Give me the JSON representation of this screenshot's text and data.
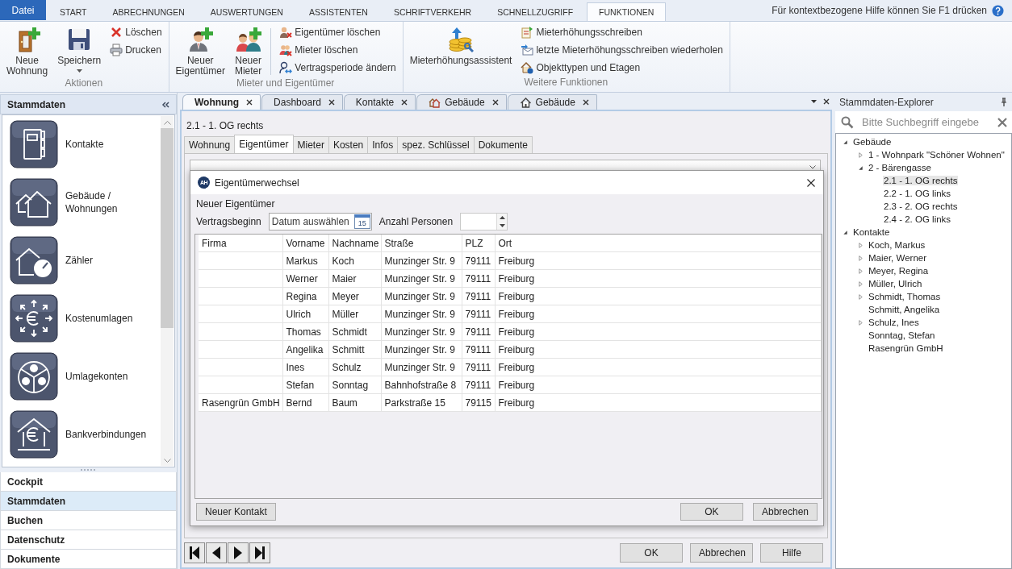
{
  "ribbon": {
    "file_button": "Datei",
    "tabs": [
      {
        "label": "START",
        "selected": false
      },
      {
        "label": "ABRECHNUNGEN",
        "selected": false
      },
      {
        "label": "AUSWERTUNGEN",
        "selected": false
      },
      {
        "label": "ASSISTENTEN",
        "selected": false
      },
      {
        "label": "SCHRIFTVERKEHR",
        "selected": false
      },
      {
        "label": "SCHNELLZUGRIFF",
        "selected": false
      },
      {
        "label": "FUNKTIONEN",
        "selected": true
      }
    ],
    "help_hint": "Für kontextbezogene Hilfe können Sie F1 drücken",
    "groups": [
      {
        "label": "Aktionen",
        "divided": false,
        "items": [
          {
            "kind": "large",
            "label": "Neue Wohnung"
          },
          {
            "kind": "split",
            "label": "Speichern"
          },
          {
            "kind": "small",
            "label": "Löschen"
          },
          {
            "kind": "small",
            "label": "Drucken"
          }
        ]
      },
      {
        "label": "Mieter und Eigentümer",
        "divided": true,
        "items": [
          {
            "kind": "large",
            "label": "Neuer Eigentümer"
          },
          {
            "kind": "large",
            "label": "Neuer Mieter"
          },
          {
            "kind": "small",
            "label": "Eigentümer löschen"
          },
          {
            "kind": "small",
            "label": "Mieter löschen"
          },
          {
            "kind": "small",
            "label": "Vertragsperiode ändern"
          }
        ]
      },
      {
        "label": "Weitere Funktionen",
        "divided": false,
        "items": [
          {
            "kind": "large",
            "label": "Mieterhöhungsassistent"
          },
          {
            "kind": "small",
            "label": "Mieterhöhungsschreiben"
          },
          {
            "kind": "small",
            "label": "letzte Mieterhöhungsschreiben wiederholen"
          },
          {
            "kind": "small",
            "label": "Objekttypen und Etagen"
          }
        ]
      }
    ]
  },
  "sidebar": {
    "title": "Stammdaten",
    "items": [
      {
        "label": "Kontakte"
      },
      {
        "label": "Gebäude / Wohnungen"
      },
      {
        "label": "Zähler"
      },
      {
        "label": "Kostenumlagen"
      },
      {
        "label": "Umlagekonten"
      },
      {
        "label": "Bankverbindungen"
      }
    ],
    "nav": [
      {
        "label": "Cockpit",
        "selected": false
      },
      {
        "label": "Stammdaten",
        "selected": true
      },
      {
        "label": "Buchen",
        "selected": false
      },
      {
        "label": "Datenschutz",
        "selected": false
      },
      {
        "label": "Dokumente",
        "selected": false
      }
    ]
  },
  "documents": {
    "tabs": [
      {
        "label": "Wohnung",
        "kind": "plain",
        "selected": true
      },
      {
        "label": "Dashboard",
        "kind": "plain",
        "selected": false
      },
      {
        "label": "Kontakte",
        "kind": "plain",
        "selected": false
      },
      {
        "label": "Gebäude",
        "kind": "buildings",
        "selected": false
      },
      {
        "label": "Gebäude",
        "kind": "house",
        "selected": false
      }
    ]
  },
  "record": {
    "title": "2.1 - 1. OG rechts",
    "tabs": [
      {
        "label": "Wohnung",
        "selected": false
      },
      {
        "label": "Eigentümer",
        "selected": true
      },
      {
        "label": "Mieter",
        "selected": false
      },
      {
        "label": "Kosten",
        "selected": false
      },
      {
        "label": "Infos",
        "selected": false
      },
      {
        "label": "spez. Schlüssel",
        "selected": false
      },
      {
        "label": "Dokumente",
        "selected": false
      }
    ],
    "buttons": [
      "OK",
      "Abbrechen",
      "Hilfe"
    ]
  },
  "dialog": {
    "logo": "AH",
    "title": "Eigentümerwechsel",
    "section": "Neuer Eigentümer",
    "start_label": "Vertragsbeginn",
    "date_field": {
      "placeholder": "Datum auswählen",
      "calendar_day": "15"
    },
    "persons_label": "Anzahl Personen",
    "columns": [
      "Firma",
      "Vorname",
      "Nachname",
      "Straße",
      "PLZ",
      "Ort"
    ],
    "rows": [
      {
        "vorname": "Markus",
        "nachname": "Koch",
        "strasse": "Munzinger Str. 9",
        "plz": "79111",
        "ort": "Freiburg",
        "selected": false
      },
      {
        "vorname": "Werner",
        "nachname": "Maier",
        "strasse": "Munzinger Str. 9",
        "plz": "79111",
        "ort": "Freiburg",
        "selected": false
      },
      {
        "vorname": "Regina",
        "nachname": "Meyer",
        "strasse": "Munzinger Str. 9",
        "plz": "79111",
        "ort": "Freiburg",
        "selected": false
      },
      {
        "vorname": "Ulrich",
        "nachname": "Müller",
        "strasse": "Munzinger Str. 9",
        "plz": "79111",
        "ort": "Freiburg",
        "selected": false
      },
      {
        "vorname": "Thomas",
        "nachname": "Schmidt",
        "strasse": "Munzinger Str. 9",
        "plz": "79111",
        "ort": "Freiburg",
        "selected": false
      },
      {
        "vorname": "Angelika",
        "nachname": "Schmitt",
        "strasse": "Munzinger Str. 9",
        "plz": "79111",
        "ort": "Freiburg",
        "selected": false
      },
      {
        "vorname": "Ines",
        "nachname": "Schulz",
        "strasse": "Munzinger Str. 9",
        "plz": "79111",
        "ort": "Freiburg",
        "selected": false
      },
      {
        "vorname": "Stefan",
        "nachname": "Sonntag",
        "strasse": "Bahnhofstraße 8",
        "plz": "79111",
        "ort": "Freiburg",
        "selected": false
      },
      {
        "firma": "Rasengrün GmbH",
        "vorname": "Bernd",
        "nachname": "Baum",
        "strasse": "Parkstraße 15",
        "plz": "79115",
        "ort": "Freiburg",
        "selected": false
      }
    ],
    "left_buttons": [
      "Neuer Kontakt"
    ],
    "right_buttons": [
      "OK",
      "Abbrechen"
    ]
  },
  "explorer": {
    "title": "Stammdaten-Explorer",
    "search": {
      "placeholder": "Bitte Suchbegriff eingebe"
    },
    "tree": [
      {
        "label": "Gebäude",
        "expanded": true,
        "selected": false,
        "children": [
          {
            "label": "1 - Wohnpark \"Schöner Wohnen\"",
            "expanded": false,
            "selected": false
          },
          {
            "label": "2 - Bärengasse",
            "expanded": true,
            "selected": false,
            "children": [
              {
                "label": "2.1 - 1. OG rechts",
                "selected": true
              },
              {
                "label": "2.2 - 1. OG links",
                "selected": false
              },
              {
                "label": "2.3 - 2. OG rechts",
                "selected": false
              },
              {
                "label": "2.4 - 2. OG links",
                "selected": false
              }
            ]
          }
        ]
      },
      {
        "label": "Kontakte",
        "expanded": true,
        "selected": false,
        "children": [
          {
            "label": "Koch, Markus",
            "expanded": false,
            "selected": false
          },
          {
            "label": "Maier, Werner",
            "expanded": false,
            "selected": false
          },
          {
            "label": "Meyer, Regina",
            "expanded": false,
            "selected": false
          },
          {
            "label": "Müller, Ulrich",
            "expanded": false,
            "selected": false
          },
          {
            "label": "Schmidt, Thomas",
            "expanded": false,
            "selected": false
          },
          {
            "label": "Schmitt, Angelika",
            "selected": false
          },
          {
            "label": "Schulz, Ines",
            "expanded": false,
            "selected": false
          },
          {
            "label": "Sonntag, Stefan",
            "selected": false
          },
          {
            "label": "Rasengrün GmbH",
            "selected": false
          }
        ]
      }
    ]
  }
}
